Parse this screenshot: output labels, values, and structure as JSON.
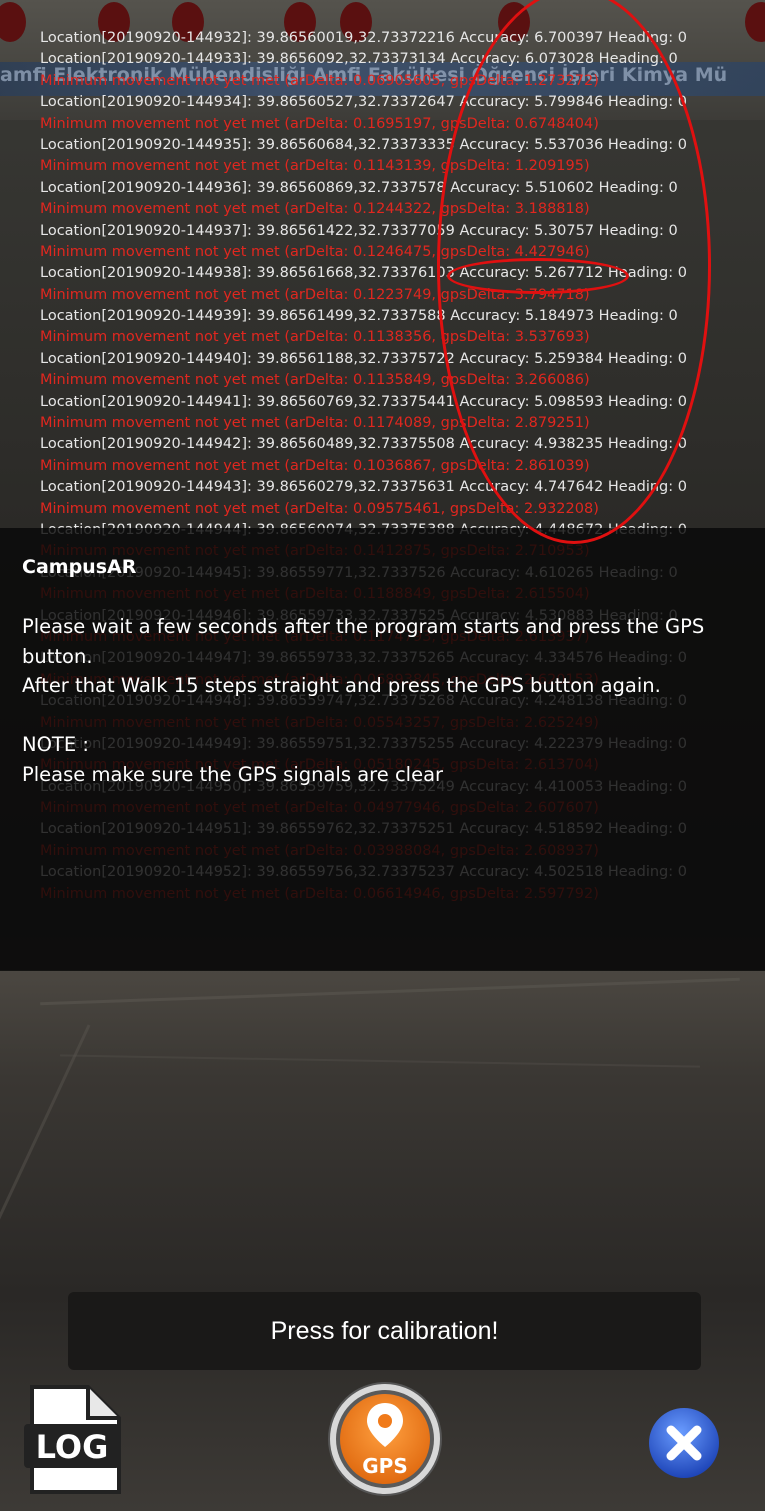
{
  "app": {
    "title": "CampusAR"
  },
  "background": {
    "banner_text": "amfi   Elektronik Mühendisliği Amfi   Fakültesi   Öğrenci İşleri           Kimya Mü"
  },
  "log": {
    "lines": [
      {
        "type": "loc",
        "text": "Location[20190920-144932]: 39.86560019,32.73372216   Accuracy: 6.700397   Heading: 0"
      },
      {
        "type": "loc",
        "text": "Location[20190920-144933]: 39.8656092,32.73373134   Accuracy: 6.073028   Heading: 0"
      },
      {
        "type": "warn",
        "text": "Minimum movement not yet met (arDelta: 0.06905605, gpsDelta: 1.273272)"
      },
      {
        "type": "loc",
        "text": "Location[20190920-144934]: 39.86560527,32.73372647   Accuracy: 5.799846   Heading: 0"
      },
      {
        "type": "warn",
        "text": "Minimum movement not yet met (arDelta: 0.1695197, gpsDelta: 0.6748404)"
      },
      {
        "type": "loc",
        "text": "Location[20190920-144935]: 39.86560684,32.73373335   Accuracy: 5.537036   Heading: 0"
      },
      {
        "type": "warn",
        "text": "Minimum movement not yet met (arDelta: 0.1143139, gpsDelta: 1.209195)"
      },
      {
        "type": "loc",
        "text": "Location[20190920-144936]: 39.86560869,32.7337578   Accuracy: 5.510602   Heading: 0"
      },
      {
        "type": "warn",
        "text": "Minimum movement not yet met (arDelta: 0.1244322, gpsDelta: 3.188818)"
      },
      {
        "type": "loc",
        "text": "Location[20190920-144937]: 39.86561422,32.73377059   Accuracy: 5.30757 Heading: 0"
      },
      {
        "type": "warn",
        "text": "Minimum movement not yet met (arDelta: 0.1246475, gpsDelta: 4.427946)"
      },
      {
        "type": "loc",
        "text": "Location[20190920-144938]: 39.86561668,32.73376103   Accuracy: 5.267712   Heading: 0"
      },
      {
        "type": "warn",
        "text": "Minimum movement not yet met (arDelta: 0.1223749, gpsDelta: 3.794718)"
      },
      {
        "type": "loc",
        "text": "Location[20190920-144939]: 39.86561499,32.7337588   Accuracy: 5.184973   Heading: 0"
      },
      {
        "type": "warn",
        "text": "Minimum movement not yet met (arDelta: 0.1138356, gpsDelta: 3.537693)"
      },
      {
        "type": "loc",
        "text": "Location[20190920-144940]: 39.86561188,32.73375722   Accuracy: 5.259384   Heading: 0"
      },
      {
        "type": "warn",
        "text": "Minimum movement not yet met (arDelta: 0.1135849, gpsDelta: 3.266086)"
      },
      {
        "type": "loc",
        "text": "Location[20190920-144941]: 39.86560769,32.73375441   Accuracy: 5.098593   Heading: 0"
      },
      {
        "type": "warn",
        "text": "Minimum movement not yet met (arDelta: 0.1174089, gpsDelta: 2.879251)"
      },
      {
        "type": "loc",
        "text": "Location[20190920-144942]: 39.86560489,32.73375508   Accuracy: 4.938235   Heading: 0"
      },
      {
        "type": "warn",
        "text": "Minimum movement not yet met (arDelta: 0.1036867, gpsDelta: 2.861039)"
      },
      {
        "type": "loc",
        "text": "Location[20190920-144943]: 39.86560279,32.73375631   Accuracy: 4.747642   Heading: 0"
      },
      {
        "type": "warn",
        "text": "Minimum movement not yet met (arDelta: 0.09575461, gpsDelta: 2.932208)"
      },
      {
        "type": "loc",
        "text": "Location[20190920-144944]: 39.86560074,32.73375388   Accuracy: 4.448672   Heading: 0"
      },
      {
        "type": "warn",
        "text": "Minimum movement not yet met (arDelta: 0.1412875, gpsDelta: 2.710953)"
      },
      {
        "type": "loc",
        "text": "Location[20190920-144945]: 39.86559771,32.7337526   Accuracy: 4.610265   Heading: 0"
      },
      {
        "type": "warn",
        "text": "Minimum movement not yet met (arDelta: 0.1188849, gpsDelta: 2.615504)"
      },
      {
        "type": "loc",
        "text": "Location[20190920-144946]: 39.86559733,32.7337525   Accuracy: 4.530883   Heading: 0"
      },
      {
        "type": "warn",
        "text": "Minimum movement not yet met (arDelta: 0.1174793, gpsDelta: 2.613937)"
      },
      {
        "type": "loc",
        "text": "Location[20190920-144947]: 39.86559733,32.73375265   Accuracy: 4.334576   Heading: 0"
      },
      {
        "type": "warn",
        "text": "Minimum movement not yet met (arDelta: 0.06893845, gpsDelta: 2.620153)"
      },
      {
        "type": "loc",
        "text": "Location[20190920-144948]: 39.86559747,32.73375268   Accuracy: 4.248138   Heading: 0"
      },
      {
        "type": "warn",
        "text": "Minimum movement not yet met (arDelta: 0.05543257, gpsDelta: 2.625249)"
      },
      {
        "type": "loc",
        "text": "Location[20190920-144949]: 39.86559751,32.73375255   Accuracy: 4.222379   Heading: 0"
      },
      {
        "type": "warn",
        "text": "Minimum movement not yet met (arDelta: 0.05180245, gpsDelta: 2.613704)"
      },
      {
        "type": "loc",
        "text": "Location[20190920-144950]: 39.86559759,32.73375249   Accuracy: 4.410053   Heading: 0"
      },
      {
        "type": "warn",
        "text": "Minimum movement not yet met (arDelta: 0.04977946, gpsDelta: 2.607607)"
      },
      {
        "type": "loc",
        "text": "Location[20190920-144951]: 39.86559762,32.73375251   Accuracy: 4.518592   Heading: 0"
      },
      {
        "type": "warn",
        "text": "Minimum movement not yet met (arDelta: 0.03988084, gpsDelta: 2.608937)"
      },
      {
        "type": "loc",
        "text": "Location[20190920-144952]: 39.86559756,32.73375237   Accuracy: 4.502518   Heading: 0"
      },
      {
        "type": "warn",
        "text": "Minimum movement not yet met (arDelta: 0.06614946, gpsDelta: 2.597792)"
      }
    ]
  },
  "dialog": {
    "title": "CampusAR",
    "lines": [
      "Please wait a few seconds after the program starts and press the GPS button.",
      "After that Walk 15 steps straight and press the GPS button again.",
      "",
      "NOTE :",
      "Please make sure the GPS signals are clear"
    ]
  },
  "controls": {
    "calibration_label": "Press for calibration!",
    "log_label": "LOG",
    "gps_label": "GPS",
    "close_icon": "close-x-icon"
  },
  "colors": {
    "log_text": "#e6e6e6",
    "log_warning": "#e0271f",
    "annotation": "#e01010",
    "gps_orange": "#f07a1a",
    "close_blue": "#2f5fd0"
  }
}
